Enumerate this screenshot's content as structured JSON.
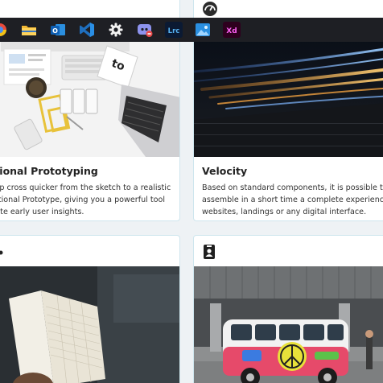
{
  "taskbar": {
    "apps": [
      {
        "icon": "chrome-icon"
      },
      {
        "icon": "file-explorer-icon"
      },
      {
        "icon": "outlook-icon",
        "label": "O"
      },
      {
        "icon": "vscode-icon"
      },
      {
        "icon": "settings-gear-icon"
      },
      {
        "icon": "discord-icon"
      },
      {
        "icon": "lightroom-classic-icon",
        "label": "Lrc"
      },
      {
        "icon": "photos-icon"
      },
      {
        "icon": "adobe-xd-icon",
        "label": "Xd"
      }
    ]
  },
  "cards": {
    "prototyping": {
      "title": "nctional Prototyping",
      "lines": [
        "tstrap cross quicker from the sketch to a realistic",
        "functional Prototype, giving you a powerful tool",
        "alidate early user insights."
      ]
    },
    "velocity": {
      "title": "Velocity",
      "lines": [
        "Based on standard components, it is possible to",
        "assemble in a short time a complete experience for",
        "websites, landings or any digital interface."
      ]
    }
  },
  "colors": {
    "card_border": "#cfe6ee",
    "taskbar_bg": "#1e1f24",
    "page_bg": "#eef2f5"
  }
}
